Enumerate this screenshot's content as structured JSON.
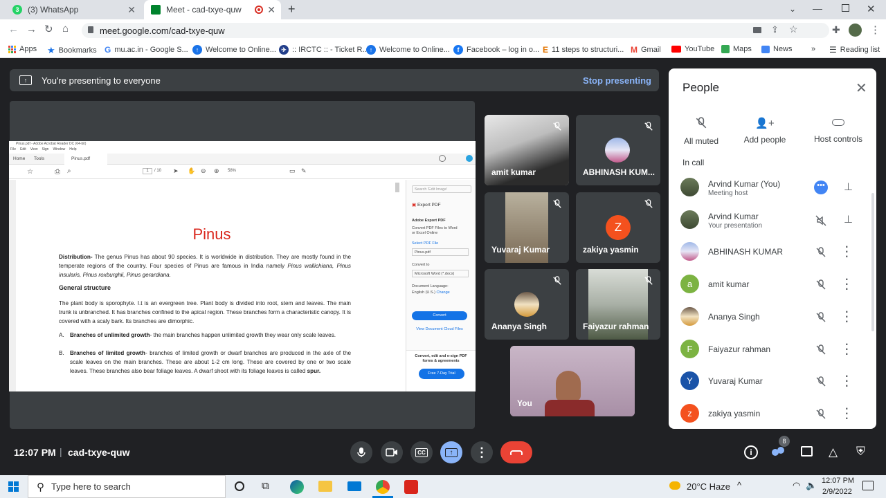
{
  "browser": {
    "tabs": [
      {
        "label": "(3) WhatsApp",
        "badge": "3"
      },
      {
        "label": "Meet - cad-txye-quw"
      }
    ],
    "url": "meet.google.com/cad-txye-quw",
    "bookmarks": [
      "Apps",
      "Bookmarks",
      "mu.ac.in - Google S...",
      "Welcome to Online...",
      ":: IRCTC :: - Ticket R...",
      "Welcome to Online...",
      "Facebook – log in o...",
      "11 steps to structuri...",
      "Gmail",
      "YouTube",
      "Maps",
      "News"
    ],
    "overflow": "»",
    "reading_list": "Reading list"
  },
  "meet": {
    "banner_text": "You're presenting to everyone",
    "stop_presenting": "Stop presenting",
    "time": "12:07 PM",
    "separator": "|",
    "meeting_code": "cad-txye-quw",
    "participant_count": "8"
  },
  "pdf": {
    "window_title": "Pinus.pdf - Adobe Acrobat Reader DC (64-bit)",
    "menu": [
      "File",
      "Edit",
      "View",
      "Sign",
      "Window",
      "Help"
    ],
    "tabs": [
      "Home",
      "Tools",
      "Pinus.pdf"
    ],
    "page": "1",
    "total": "/ 10",
    "zoom": "58%",
    "title": "Pinus",
    "dist_label": "Distribution-",
    "dist_text": " The genus Pinus has about 90 species. It is worldwide in distribution. They are mostly found in the temperate regions of the country. Four species of Pinus are famous in India namely ",
    "dist_species": "Pinus wallichiana,  Pinus insularis, Pinus roxburghii,  Pinus gerardiana.",
    "gs_heading": "General structure",
    "gs_text": "The plant body is sporophyte. I.t is an evergreen tree. Plant body is divided into root, stem and leaves. The main trunk is unbranched. It has branches confined to the apical region. These branches form a characteristic canopy. It is covered with a scaly bark. Its branches are dimorphic.",
    "item_a_marker": "A.",
    "item_a_label": "Branches of unlimited growth",
    "item_a_text": "- the main branches happen unlimited growth they wear only scale leaves.",
    "item_b_marker": "B.",
    "item_b_label": "Branches of limited growth",
    "item_b_text": "- branches of limited growth or dwarf branches are produced in the axle of the scale leaves on the main branches. These are about 1-2 cm long. These are covered by one or two scale leaves. These branches also bear foliage leaves. A dwarf shoot with its foliage leaves is called ",
    "item_b_end": "spur.",
    "side": {
      "search": "Search 'Edit Image'",
      "export": "Export PDF",
      "adobe_export": "Adobe Export PDF",
      "convert_desc": "Convert PDF Files to Word or Excel Online",
      "select": "Select PDF File",
      "file": "Pinus.pdf",
      "convert_to": "Convert to",
      "format": "Microsoft Word (*.docx)",
      "doc_lang": "Document Language:",
      "lang": "English (U.S.)",
      "change": "Change",
      "convert_btn": "Convert",
      "view_cloud": "View Document Cloud Files",
      "promo": "Convert, edit and e-sign PDF forms & agreements",
      "trial": "Free 7-Day Trial"
    }
  },
  "tiles": [
    "amit kumar",
    "ABHINASH KUM...",
    "Yuvaraj Kumar",
    "zakiya yasmin",
    "Ananya Singh",
    "Faiyazur rahman",
    "You"
  ],
  "tile_letter_z": "Z",
  "people": {
    "title": "People",
    "actions": [
      "All muted",
      "Add people",
      "Host controls"
    ],
    "section": "In call",
    "list": [
      {
        "name": "Arvind Kumar (You)",
        "sub": "Meeting host"
      },
      {
        "name": "Arvind Kumar",
        "sub": "Your presentation"
      },
      {
        "name": "ABHINASH KUMAR",
        "sub": ""
      },
      {
        "name": "amit kumar",
        "sub": "",
        "letter": "a"
      },
      {
        "name": "Ananya Singh",
        "sub": ""
      },
      {
        "name": "Faiyazur rahman",
        "sub": "",
        "letter": "F"
      },
      {
        "name": "Yuvaraj Kumar",
        "sub": "",
        "letter": "Y"
      },
      {
        "name": "zakiya yasmin",
        "sub": "",
        "letter": "z"
      }
    ]
  },
  "taskbar": {
    "search": "Type here to search",
    "weather": "20°C  Haze",
    "time": "12:07 PM",
    "date": "2/9/2022"
  },
  "colors": {
    "accent": "#8ab4f8",
    "end_call": "#ea4335",
    "present_active": "#8ab4f8"
  }
}
